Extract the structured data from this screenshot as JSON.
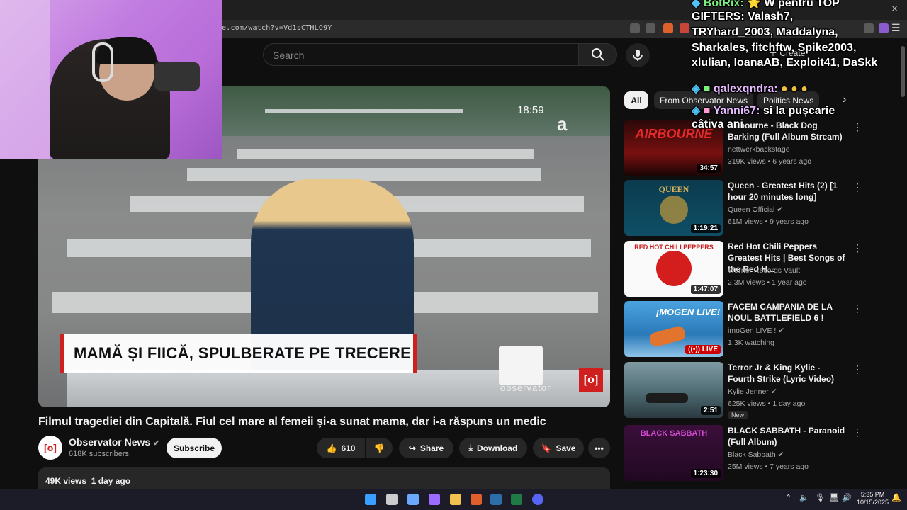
{
  "browser": {
    "url": "e.com/watch?v=Vd1sCTHLO9Y"
  },
  "header": {
    "search_placeholder": "Search",
    "create_label": "Create"
  },
  "video_player": {
    "lower_third": "MAMĂ ȘI FIICĂ, SPULBERATE PE TRECERE",
    "clock": "18:59",
    "watermark": "observator",
    "channel_logo": "a"
  },
  "video": {
    "title": "Filmul tragediei din Capitală. Fiul cel mare al femeii şi-a sunat mama, dar i-a răspuns un medic",
    "views": "49K views",
    "age": "1 day ago"
  },
  "channel": {
    "name": "Observator News",
    "subscribers": "618K subscribers",
    "subscribe_label": "Subscribe"
  },
  "actions": {
    "likes": "610",
    "share": "Share",
    "download": "Download",
    "save": "Save"
  },
  "chips": [
    "All",
    "From Observator News",
    "Politics News"
  ],
  "recommendations": [
    {
      "title": "Airbourne - Black Dog Barking (Full Album Stream)",
      "channel": "nettwerkbackstage",
      "meta": "319K views • 6 years ago",
      "duration": "34:57",
      "thumb_text": "AIRBOURNE"
    },
    {
      "title": "Queen - Greatest Hits (2) [1 hour 20 minutes long]",
      "channel": "Queen Official",
      "meta": "61M views • 9 years ago",
      "duration": "1:19:21",
      "thumb_text": "QUEEN"
    },
    {
      "title": "Red Hot Chili Peppers Greatest Hits | Best Songs of the Red H...",
      "channel": "Warner Records Vault",
      "meta": "2.3M views • 1 year ago",
      "duration": "1:47:07",
      "thumb_text": "RED HOT CHILI PEPPERS"
    },
    {
      "title": "FACEM CAMPANIA DE LA NOUL BATTLEFIELD 6 !",
      "channel": "imoGen LIVE !",
      "meta": "1.3K watching",
      "live": "LIVE",
      "thumb_text": "¡MOGEN LIVE!"
    },
    {
      "title": "Terror Jr & King Kylie - Fourth Strike (Lyric Video)",
      "channel": "Kylie Jenner",
      "meta": "625K views • 1 day ago",
      "duration": "2:51",
      "badge": "New",
      "thumb_text": ""
    },
    {
      "title": "BLACK SABBATH - Paranoid (Full Album)",
      "channel": "Black Sabbath",
      "meta": "25M views • 7 years ago",
      "duration": "1:23:30",
      "thumb_text": "BLACK SABBATH"
    }
  ],
  "chat": [
    {
      "name": "BotRix:",
      "text": "⭐ W pentru TOP"
    },
    {
      "text": "GIFTERS: Valash7,"
    },
    {
      "text": "TRYhard_2003, Maddalyna,"
    },
    {
      "text": "Sharkales, fitchftw, Spike2003,"
    },
    {
      "text": "xlulian, IoanaAB, Exploit41, DaSkk"
    },
    {
      "name": "qalexqndra:",
      "text": ""
    },
    {
      "name": "Yanni67:",
      "text": "si la pușcarie"
    },
    {
      "text": "câtiva ani"
    }
  ],
  "taskbar": {
    "time": "5:35 PM",
    "date": "10/15/2025"
  },
  "colors": {
    "background": "#0f0f0f",
    "accent_red": "#cc0000",
    "observator_red": "#d01f1f",
    "chat_name": "#e6b8ff"
  }
}
